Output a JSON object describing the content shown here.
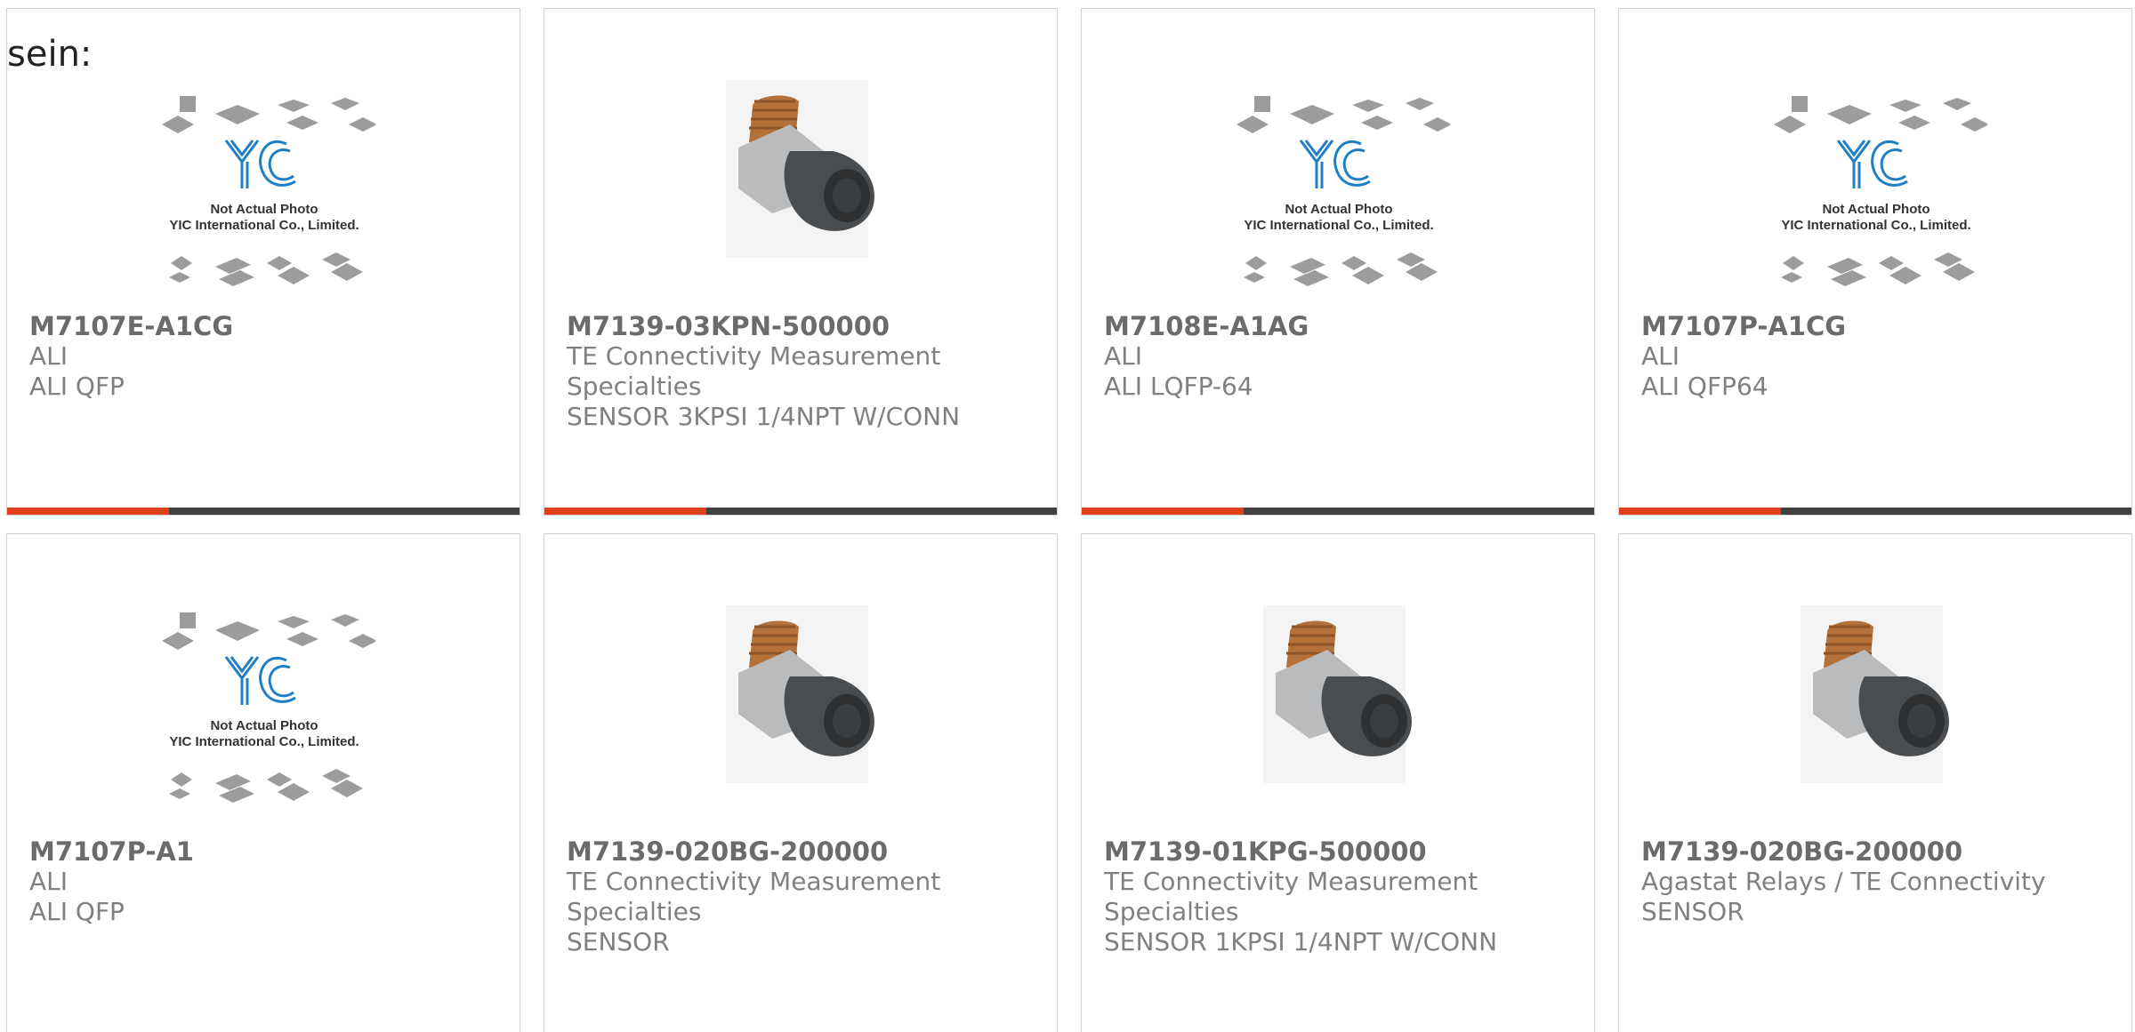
{
  "intro_text": "sein:",
  "placeholder_logo": {
    "brand": "YIC",
    "line1": "Not Actual Photo",
    "line2": "YIC International Co., Limited."
  },
  "colors": {
    "accent": "#e0401c",
    "bar": "#404040",
    "text": "#808080",
    "logo": "#1f7fc4"
  },
  "products": [
    {
      "image": "placeholder",
      "part": "M7107E-A1CG",
      "maker": "ALI",
      "desc": "ALI QFP"
    },
    {
      "image": "pressure-sensor",
      "part": "M7139-03KPN-500000",
      "maker": "TE Connectivity Measurement Specialties",
      "desc": "SENSOR 3KPSI 1/4NPT W/CONN"
    },
    {
      "image": "placeholder",
      "part": "M7108E-A1AG",
      "maker": "ALI",
      "desc": "ALI LQFP-64"
    },
    {
      "image": "placeholder",
      "part": "M7107P-A1CG",
      "maker": "ALI",
      "desc": "ALI QFP64"
    },
    {
      "image": "placeholder",
      "part": "M7107P-A1",
      "maker": "ALI",
      "desc": "ALI QFP"
    },
    {
      "image": "pressure-sensor",
      "part": "M7139-020BG-200000",
      "maker": "TE Connectivity Measurement Specialties",
      "desc": "SENSOR"
    },
    {
      "image": "pressure-sensor",
      "part": "M7139-01KPG-500000",
      "maker": "TE Connectivity Measurement Specialties",
      "desc": "SENSOR 1KPSI 1/4NPT W/CONN"
    },
    {
      "image": "pressure-sensor",
      "part": "M7139-020BG-200000",
      "maker": "Agastat Relays / TE Connectivity",
      "desc": "SENSOR"
    }
  ]
}
